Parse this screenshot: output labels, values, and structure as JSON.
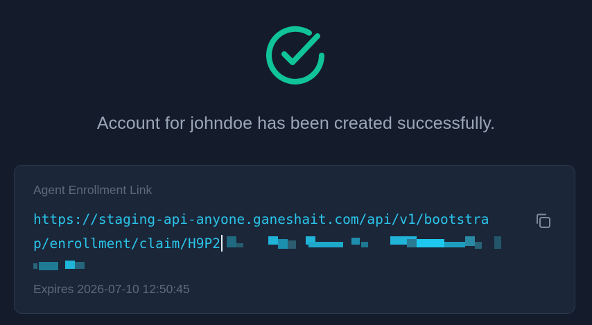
{
  "success": {
    "icon": "check-circle-icon",
    "message": "Account for johndoe has been created successfully.",
    "color": "#10c497"
  },
  "enrollment": {
    "label": "Agent Enrollment Link",
    "link_line1": "https://staging-api-anyone.ganeshait.com/api/v1/bootstra",
    "link_line2": "p/enrollment/claim/H9P2",
    "copy_icon": "copy-icon",
    "expires": "Expires 2026-07-10 12:50:45"
  },
  "colors": {
    "background": "#141c2c",
    "card": "#1b2638",
    "link": "#2bc4ea",
    "muted": "#5c6a7c",
    "message": "#9aa6b6"
  }
}
